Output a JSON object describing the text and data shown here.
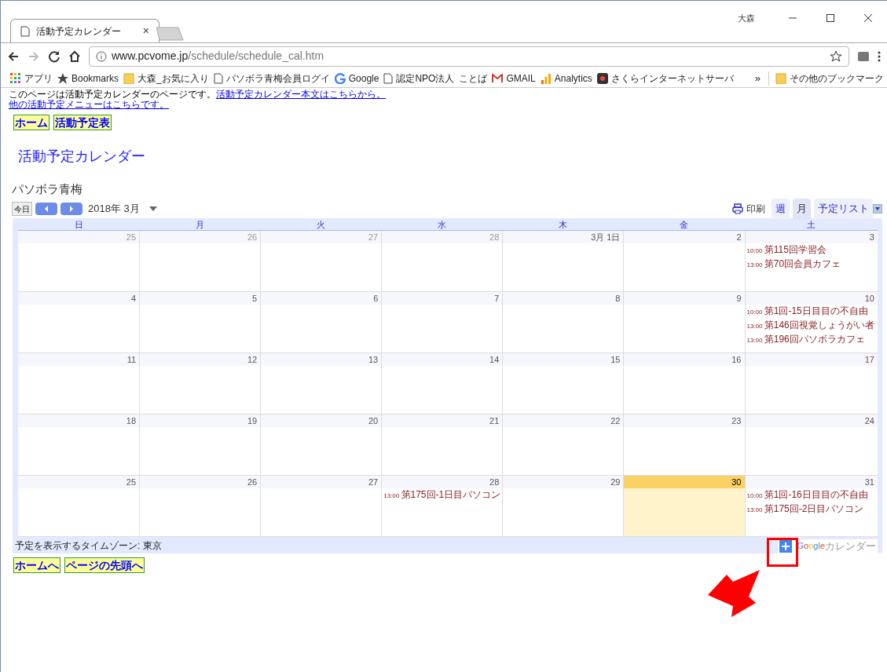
{
  "browser": {
    "user": "大森",
    "tab": {
      "title": "活動予定カレンダー",
      "close": "×"
    },
    "url_host": "www.pcvome.jp",
    "url_path": "/schedule/schedule_cal.htm",
    "bookmarks": [
      {
        "kind": "apps",
        "label": "アプリ"
      },
      {
        "kind": "star",
        "label": "Bookmarks"
      },
      {
        "kind": "folder",
        "label": "大森_お気に入り"
      },
      {
        "kind": "page",
        "label": "パソボラ青梅会員ログイ"
      },
      {
        "kind": "google",
        "label": "Google"
      },
      {
        "kind": "page",
        "label": "認定NPO法人"
      },
      {
        "kind": "none",
        "label": "ことば"
      },
      {
        "kind": "gmail",
        "label": "GMAIL"
      },
      {
        "kind": "analytics",
        "label": "Analytics"
      },
      {
        "kind": "app",
        "label": "さくらインターネットサーバ"
      }
    ],
    "overflow": "»",
    "other_bookmarks": "その他のブックマーク"
  },
  "page": {
    "intro": "このページは活動予定カレンダーのページです。",
    "intro_link": "活動予定カレンダー本文はこちらから。",
    "menu_link": "他の活動予定メニューはこちらです。",
    "top_nav": [
      "ホーム",
      "活動予定表"
    ],
    "heading": "活動予定カレンダー",
    "calendar_name": "パソボラ青梅",
    "today_button": "今日",
    "month": "2018年 3月",
    "print": "印刷",
    "views": [
      {
        "label": "週",
        "selected": false
      },
      {
        "label": "月",
        "selected": true
      },
      {
        "label": "予定リスト",
        "selected": false
      }
    ],
    "weekdays": [
      "日",
      "月",
      "火",
      "水",
      "木",
      "金",
      "土"
    ],
    "weeks": [
      [
        {
          "day": "25",
          "other_month": true,
          "today": false
        },
        {
          "day": "26",
          "other_month": true,
          "today": false
        },
        {
          "day": "27",
          "other_month": true,
          "today": false
        },
        {
          "day": "28",
          "other_month": true,
          "today": false
        },
        {
          "day": "3月 1日",
          "other_month": false,
          "today": false
        },
        {
          "day": "2",
          "other_month": false,
          "today": false
        },
        {
          "day": "3",
          "other_month": false,
          "today": false,
          "events": [
            {
              "time": "10:00",
              "title": "第115回学習会"
            },
            {
              "time": "13:00",
              "title": "第70回会員カフェ"
            }
          ]
        }
      ],
      [
        {
          "day": "4",
          "other_month": false,
          "today": false
        },
        {
          "day": "5",
          "other_month": false,
          "today": false
        },
        {
          "day": "6",
          "other_month": false,
          "today": false
        },
        {
          "day": "7",
          "other_month": false,
          "today": false
        },
        {
          "day": "8",
          "other_month": false,
          "today": false
        },
        {
          "day": "9",
          "other_month": false,
          "today": false
        },
        {
          "day": "10",
          "other_month": false,
          "today": false,
          "events": [
            {
              "time": "10:00",
              "title": "第1回-15日目目の不自由"
            },
            {
              "time": "13:00",
              "title": "第146回視覚しょうがい者"
            },
            {
              "time": "13:00",
              "title": "第196回パソボラカフェ"
            }
          ]
        }
      ],
      [
        {
          "day": "11",
          "other_month": false,
          "today": false
        },
        {
          "day": "12",
          "other_month": false,
          "today": false
        },
        {
          "day": "13",
          "other_month": false,
          "today": false
        },
        {
          "day": "14",
          "other_month": false,
          "today": false
        },
        {
          "day": "15",
          "other_month": false,
          "today": false
        },
        {
          "day": "16",
          "other_month": false,
          "today": false
        },
        {
          "day": "17",
          "other_month": false,
          "today": false
        }
      ],
      [
        {
          "day": "18",
          "other_month": false,
          "today": false
        },
        {
          "day": "19",
          "other_month": false,
          "today": false
        },
        {
          "day": "20",
          "other_month": false,
          "today": false
        },
        {
          "day": "21",
          "other_month": false,
          "today": false
        },
        {
          "day": "22",
          "other_month": false,
          "today": false
        },
        {
          "day": "23",
          "other_month": false,
          "today": false
        },
        {
          "day": "24",
          "other_month": false,
          "today": false
        }
      ],
      [
        {
          "day": "25",
          "other_month": false,
          "today": false
        },
        {
          "day": "26",
          "other_month": false,
          "today": false
        },
        {
          "day": "27",
          "other_month": false,
          "today": false
        },
        {
          "day": "28",
          "other_month": false,
          "today": false,
          "events": [
            {
              "time": "13:00",
              "title": "第175回-1日目パソコン"
            }
          ]
        },
        {
          "day": "29",
          "other_month": false,
          "today": false
        },
        {
          "day": "30",
          "other_month": false,
          "today": true
        },
        {
          "day": "31",
          "other_month": false,
          "today": false,
          "events": [
            {
              "time": "10:00",
              "title": "第1回-16日目目の不自由"
            },
            {
              "time": "13:00",
              "title": "第175回-2日目パソコン"
            }
          ]
        }
      ]
    ],
    "timezone": "予定を表示するタイムゾーン: 東京",
    "google_letters": [
      "G",
      "o",
      "o",
      "g",
      "l",
      "e"
    ],
    "google_calendar": "カレンダー",
    "bottom_nav": [
      "ホームへ",
      "ページの先頭へ"
    ]
  }
}
